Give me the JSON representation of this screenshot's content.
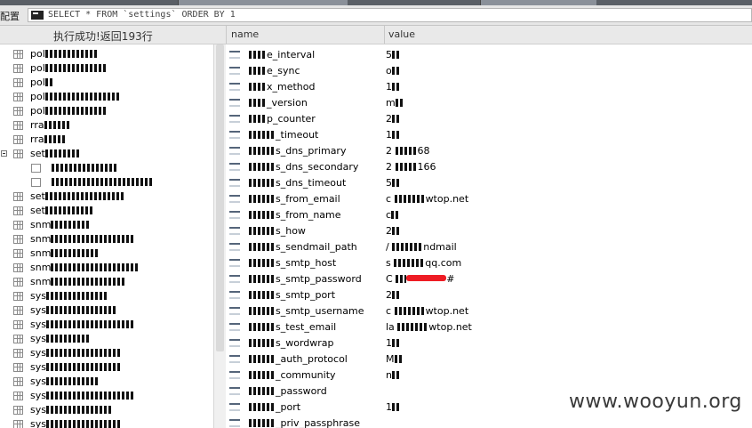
{
  "query_bar": {
    "left_text": "配置",
    "sql": "SELECT * FROM `settings` ORDER BY 1"
  },
  "status_text": "执行成功!返回193行",
  "columns": [
    "name",
    "value"
  ],
  "tree": [
    {
      "label": "pol",
      "indent": 0
    },
    {
      "label": "pol",
      "indent": 0
    },
    {
      "label": "pol",
      "indent": 0
    },
    {
      "label": "pol",
      "indent": 0
    },
    {
      "label": "pol",
      "indent": 0
    },
    {
      "label": "rra",
      "indent": 0
    },
    {
      "label": "rra",
      "indent": 0
    },
    {
      "label": "set",
      "indent": 0,
      "expanded": true
    },
    {
      "label": "",
      "indent": 1
    },
    {
      "label": "",
      "indent": 1
    },
    {
      "label": "set",
      "indent": 0
    },
    {
      "label": "set",
      "indent": 0
    },
    {
      "label": "snm",
      "indent": 0
    },
    {
      "label": "snm",
      "indent": 0
    },
    {
      "label": "snm",
      "indent": 0
    },
    {
      "label": "snm",
      "indent": 0
    },
    {
      "label": "snm",
      "indent": 0
    },
    {
      "label": "sys",
      "indent": 0
    },
    {
      "label": "sys",
      "indent": 0
    },
    {
      "label": "sys",
      "indent": 0
    },
    {
      "label": "sys",
      "indent": 0
    },
    {
      "label": "sys",
      "indent": 0
    },
    {
      "label": "sys",
      "indent": 0
    },
    {
      "label": "sys",
      "indent": 0
    },
    {
      "label": "sys",
      "indent": 0
    },
    {
      "label": "sys",
      "indent": 0
    },
    {
      "label": "sys",
      "indent": 0
    }
  ],
  "rows": [
    {
      "name": "e_interval",
      "value": "5"
    },
    {
      "name": "e_sync",
      "value": "o"
    },
    {
      "name": "x_method",
      "value": "1"
    },
    {
      "name": "_version",
      "value": "m"
    },
    {
      "name": "p_counter",
      "value": "2"
    },
    {
      "name": "_timeout",
      "value": "1"
    },
    {
      "name": "s_dns_primary",
      "value": "2",
      "value_tail": "68"
    },
    {
      "name": "s_dns_secondary",
      "value": "2",
      "value_tail": "166"
    },
    {
      "name": "s_dns_timeout",
      "value": "5"
    },
    {
      "name": "s_from_email",
      "value": "c",
      "value_tail": "wtop.net"
    },
    {
      "name": "s_from_name",
      "value": "c"
    },
    {
      "name": "s_how",
      "value": "2"
    },
    {
      "name": "s_sendmail_path",
      "value": "/",
      "value_tail": "ndmail"
    },
    {
      "name": "s_smtp_host",
      "value": "s",
      "value_tail": "qq.com"
    },
    {
      "name": "s_smtp_password",
      "value": "C",
      "value_tail": "#",
      "redacted": true
    },
    {
      "name": "s_smtp_port",
      "value": "2"
    },
    {
      "name": "s_smtp_username",
      "value": "c",
      "value_tail": "wtop.net"
    },
    {
      "name": "s_test_email",
      "value": "la",
      "value_tail": "wtop.net"
    },
    {
      "name": "s_wordwrap",
      "value": "1"
    },
    {
      "name": "_auth_protocol",
      "value": "M"
    },
    {
      "name": "_community",
      "value": "n"
    },
    {
      "name": "_password",
      "value": ""
    },
    {
      "name": "_port",
      "value": "1"
    },
    {
      "name": "_priv_passphrase",
      "value": ""
    }
  ],
  "watermark": "www.wooyun.org"
}
